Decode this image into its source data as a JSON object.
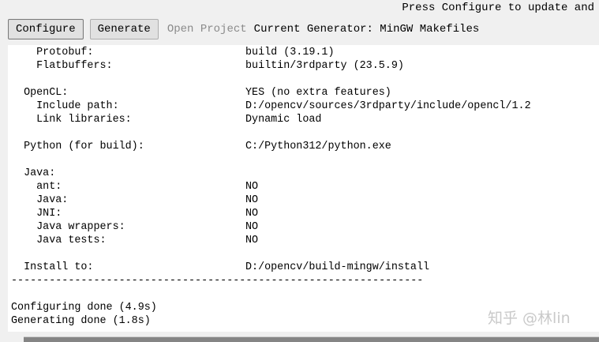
{
  "window": {
    "status_text": "Press Configure to update and"
  },
  "toolbar": {
    "configure_label": "Configure",
    "generate_label": "Generate",
    "open_project_label": "Open Project",
    "current_generator": "Current Generator: MinGW Makefiles"
  },
  "output": {
    "lines": [
      {
        "label": "    Protobuf:",
        "value": "build (3.19.1)"
      },
      {
        "label": "    Flatbuffers:",
        "value": "builtin/3rdparty (23.5.9)"
      },
      {
        "label": "",
        "value": ""
      },
      {
        "label": "  OpenCL:",
        "value": "YES (no extra features)"
      },
      {
        "label": "    Include path:",
        "value": "D:/opencv/sources/3rdparty/include/opencl/1.2"
      },
      {
        "label": "    Link libraries:",
        "value": "Dynamic load"
      },
      {
        "label": "",
        "value": ""
      },
      {
        "label": "  Python (for build):",
        "value": "C:/Python312/python.exe"
      },
      {
        "label": "",
        "value": ""
      },
      {
        "label": "  Java:",
        "value": ""
      },
      {
        "label": "    ant:",
        "value": "NO"
      },
      {
        "label": "    Java:",
        "value": "NO"
      },
      {
        "label": "    JNI:",
        "value": "NO"
      },
      {
        "label": "    Java wrappers:",
        "value": "NO"
      },
      {
        "label": "    Java tests:",
        "value": "NO"
      },
      {
        "label": "",
        "value": ""
      },
      {
        "label": "  Install to:",
        "value": "D:/opencv/build-mingw/install"
      },
      {
        "label": "-----------------------------------------------------------------",
        "value": ""
      },
      {
        "label": "",
        "value": ""
      },
      {
        "label": "Configuring done (4.9s)",
        "value": ""
      },
      {
        "label": "Generating done (1.8s)",
        "value": ""
      }
    ]
  },
  "watermark": {
    "text": "知乎 @林lin"
  }
}
